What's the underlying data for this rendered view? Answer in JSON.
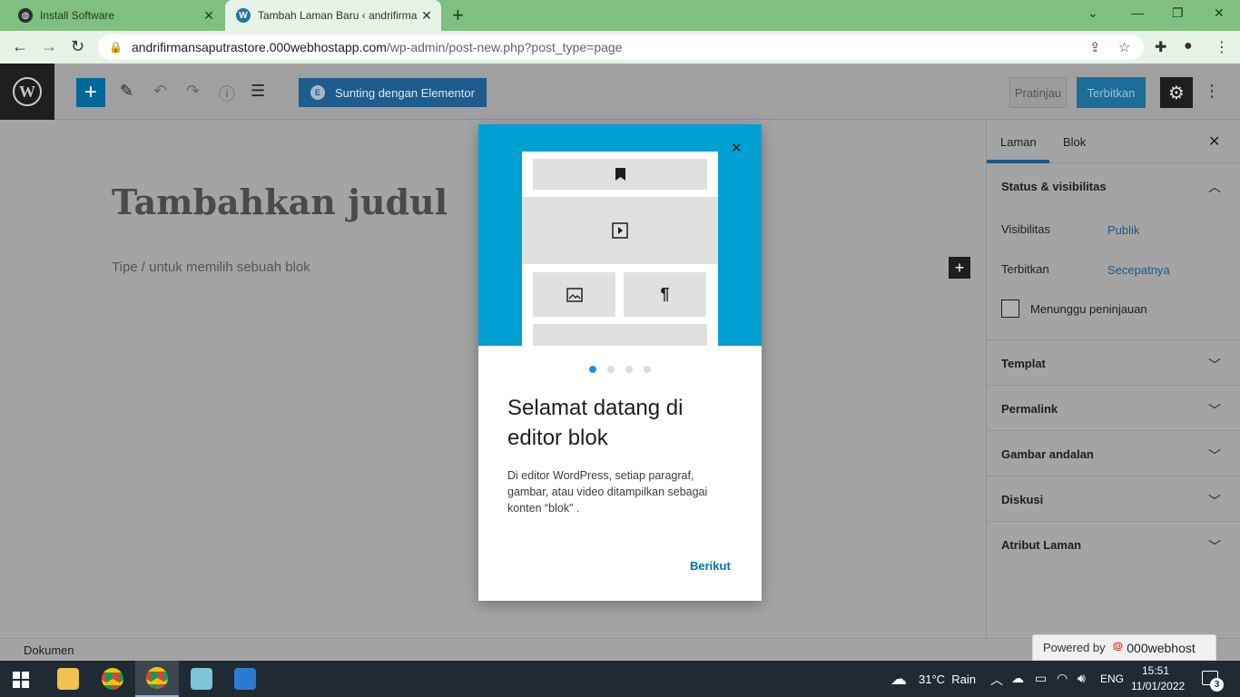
{
  "browser": {
    "tabs": [
      {
        "title": "Install Software",
        "icon": "globe-icon"
      },
      {
        "title": "Tambah Laman Baru ‹ andrifirman",
        "icon": "wordpress-icon"
      }
    ],
    "new_tab": "+",
    "url_host": "andrifirmansaputrastore.000webhostapp.com",
    "url_path": "/wp-admin/post-new.php?post_type=page"
  },
  "editor": {
    "elementor_label": "Sunting dengan Elementor",
    "preview_label": "Pratinjau",
    "publish_label": "Terbitkan",
    "title_placeholder": "Tambahkan judul",
    "block_placeholder": "Tipe / untuk memilih sebuah blok"
  },
  "sidebar": {
    "tabs": [
      "Laman",
      "Blok"
    ],
    "status_panel": {
      "title": "Status & visibilitas",
      "visibility_label": "Visibilitas",
      "visibility_value": "Publik",
      "publish_label": "Terbitkan",
      "publish_value": "Secepatnya",
      "pending_label": "Menunggu peninjauan"
    },
    "panels": [
      "Templat",
      "Permalink",
      "Gambar andalan",
      "Diskusi",
      "Atribut Laman"
    ]
  },
  "modal": {
    "title": "Selamat datang di editor blok",
    "description": "Di editor WordPress, setiap paragraf, gambar, atau video ditampilkan sebagai konten “blok” .",
    "next_label": "Berikut",
    "pages": 4,
    "current_page": 1
  },
  "footer": {
    "breadcrumb": "Dokumen",
    "powered_label": "Powered by",
    "powered_brand": "000webhost"
  },
  "taskbar": {
    "weather": "31°C  Rain",
    "language": "ENG",
    "time": "15:51",
    "date": "11/01/2022",
    "notifications": "3"
  },
  "colors": {
    "browser_frame": "#7fbf7f",
    "wp_blue": "#006799",
    "modal_hero": "#00a0d2",
    "link": "#0073aa"
  }
}
